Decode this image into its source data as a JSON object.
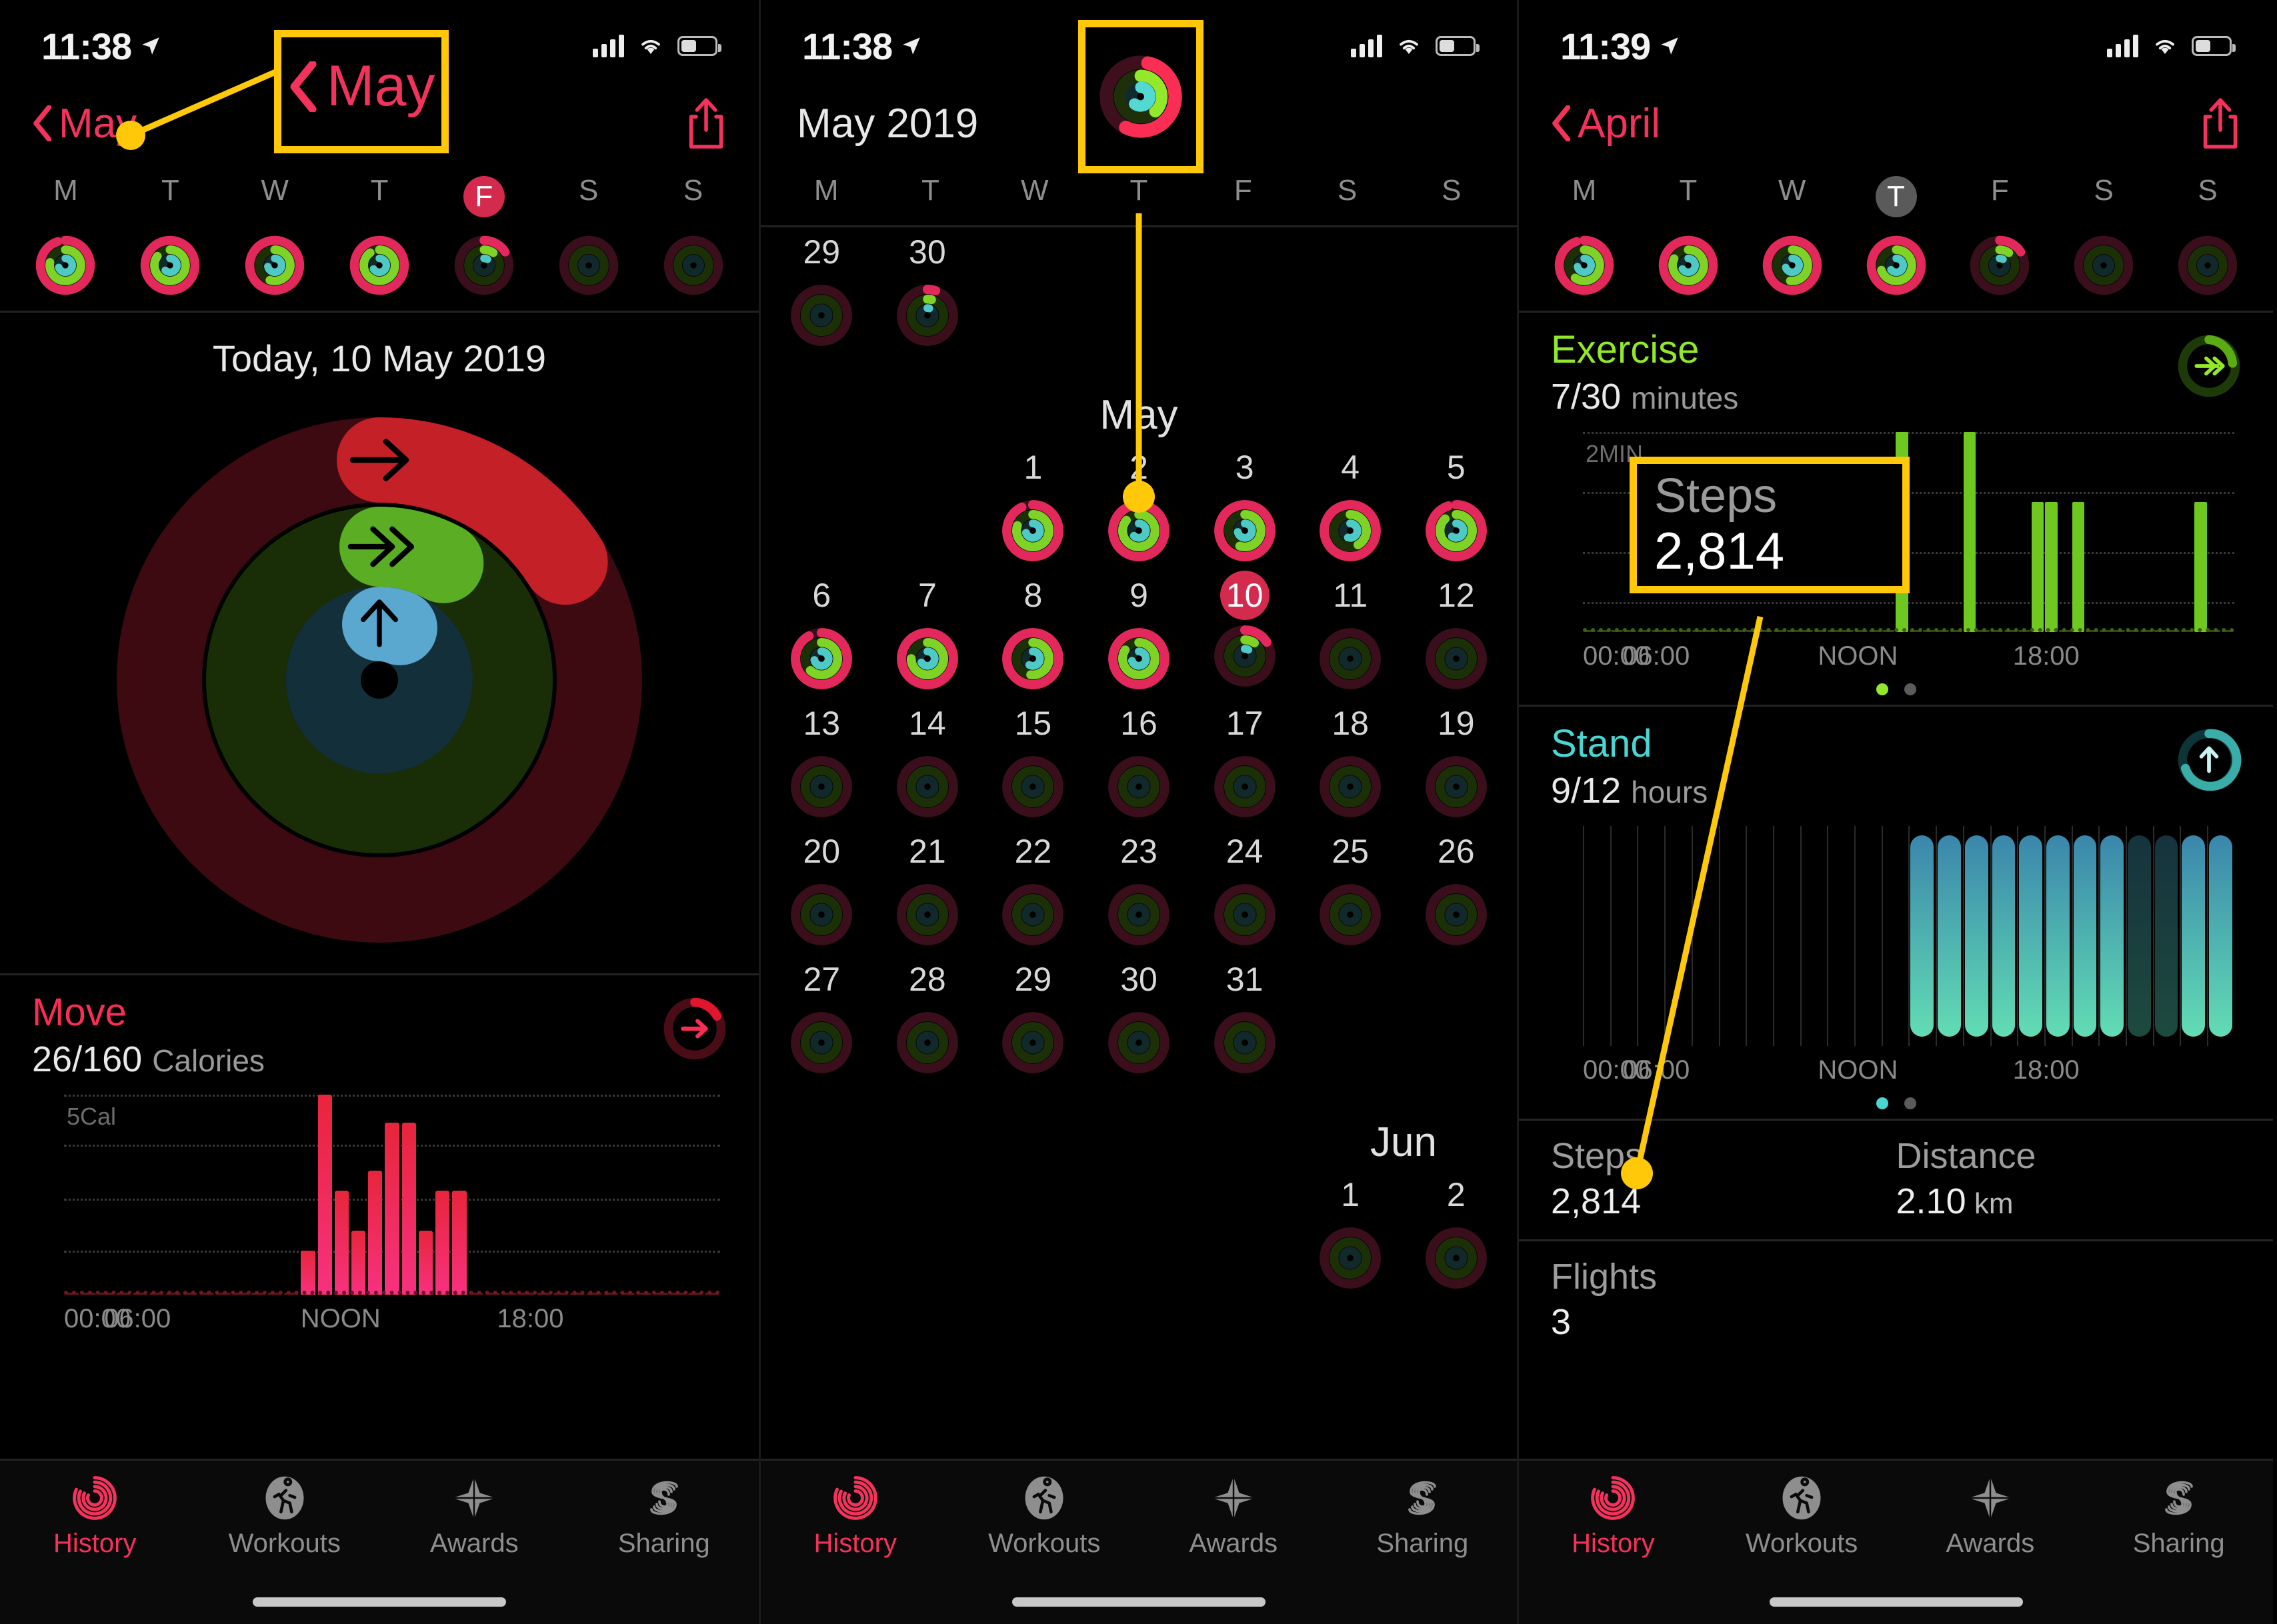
{
  "colors": {
    "move": "#fa2d55",
    "exercise": "#92e82a",
    "stand": "#4ad7d4",
    "accent_red": "#f4335c",
    "today_pill": "#d42a4e",
    "annotation": "#ffc909"
  },
  "panel1": {
    "status": {
      "time": "11:38"
    },
    "nav": {
      "back_label": "May",
      "share_icon": "share-icon"
    },
    "weekdays": [
      "M",
      "T",
      "W",
      "T",
      "F",
      "S",
      "S"
    ],
    "today_index": 4,
    "today_style": "red",
    "day_rings": [
      {
        "move": 0.95,
        "exercise": 0.78,
        "stand": 0.7
      },
      {
        "move": 1.0,
        "exercise": 0.85,
        "stand": 0.62
      },
      {
        "move": 1.0,
        "exercise": 0.55,
        "stand": 0.72
      },
      {
        "move": 1.0,
        "exercise": 0.9,
        "stand": 0.66
      },
      {
        "move": 0.16,
        "exercise": 0.1,
        "stand": 0.08
      },
      {
        "move": 0.0,
        "exercise": 0.0,
        "stand": 0.0
      },
      {
        "move": 0.0,
        "exercise": 0.0,
        "stand": 0.0
      }
    ],
    "today_label": "Today, 10 May 2019",
    "big_ring": {
      "move": 0.16,
      "exercise": 0.08,
      "stand": 0.06
    },
    "move": {
      "title": "Move",
      "value": "26/160",
      "unit": "Calories",
      "ylabel": "5Cal",
      "badge_icon": "arrow-right-icon",
      "xticks": [
        "00:00",
        "06:00",
        "NOON",
        "18:00"
      ]
    },
    "tabs": [
      {
        "label": "History",
        "icon": "rings-icon",
        "active": true
      },
      {
        "label": "Workouts",
        "icon": "runner-icon",
        "active": false
      },
      {
        "label": "Awards",
        "icon": "star-icon",
        "active": false
      },
      {
        "label": "Sharing",
        "icon": "sharing-icon",
        "active": false
      }
    ],
    "annotation": {
      "back_label": "May"
    }
  },
  "panel2": {
    "status": {
      "time": "11:38"
    },
    "nav": {
      "title": "May 2019"
    },
    "weekdays": [
      "M",
      "T",
      "W",
      "T",
      "F",
      "S",
      "S"
    ],
    "month_label": "May",
    "next_month_label": "Jun",
    "prev_days": [
      {
        "date": "29",
        "move": 0.0,
        "exercise": 0.0,
        "stand": 0.0
      },
      {
        "date": "30",
        "move": 0.05,
        "exercise": 0.04,
        "stand": 0.04
      }
    ],
    "weeks": [
      [
        null,
        null,
        {
          "date": "1",
          "move": 0.93,
          "exercise": 0.8,
          "stand": 0.7
        },
        {
          "date": "2",
          "move": 1.0,
          "exercise": 0.86,
          "stand": 0.62
        },
        {
          "date": "3",
          "move": 1.0,
          "exercise": 0.55,
          "stand": 0.72
        },
        {
          "date": "4",
          "move": 1.0,
          "exercise": 0.42,
          "stand": 0.55
        },
        {
          "date": "5",
          "move": 0.95,
          "exercise": 0.88,
          "stand": 0.6
        }
      ],
      [
        {
          "date": "6",
          "move": 0.92,
          "exercise": 0.62,
          "stand": 0.72
        },
        {
          "date": "7",
          "move": 1.0,
          "exercise": 0.75,
          "stand": 0.66
        },
        {
          "date": "8",
          "move": 1.0,
          "exercise": 0.52,
          "stand": 0.58
        },
        {
          "date": "9",
          "move": 1.0,
          "exercise": 0.84,
          "stand": 0.7
        },
        {
          "date": "10",
          "move": 0.16,
          "exercise": 0.1,
          "stand": 0.08,
          "today": true
        },
        {
          "date": "11",
          "move": 0.0,
          "exercise": 0.0,
          "stand": 0.0
        },
        {
          "date": "12",
          "move": 0.0,
          "exercise": 0.0,
          "stand": 0.0
        }
      ],
      [
        {
          "date": "13",
          "move": 0.0,
          "exercise": 0.0,
          "stand": 0.0
        },
        {
          "date": "14",
          "move": 0.0,
          "exercise": 0.0,
          "stand": 0.0
        },
        {
          "date": "15",
          "move": 0.0,
          "exercise": 0.0,
          "stand": 0.0
        },
        {
          "date": "16",
          "move": 0.0,
          "exercise": 0.0,
          "stand": 0.0
        },
        {
          "date": "17",
          "move": 0.0,
          "exercise": 0.0,
          "stand": 0.0
        },
        {
          "date": "18",
          "move": 0.0,
          "exercise": 0.0,
          "stand": 0.0
        },
        {
          "date": "19",
          "move": 0.0,
          "exercise": 0.0,
          "stand": 0.0
        }
      ],
      [
        {
          "date": "20",
          "move": 0.0,
          "exercise": 0.0,
          "stand": 0.0
        },
        {
          "date": "21",
          "move": 0.0,
          "exercise": 0.0,
          "stand": 0.0
        },
        {
          "date": "22",
          "move": 0.0,
          "exercise": 0.0,
          "stand": 0.0
        },
        {
          "date": "23",
          "move": 0.0,
          "exercise": 0.0,
          "stand": 0.0
        },
        {
          "date": "24",
          "move": 0.0,
          "exercise": 0.0,
          "stand": 0.0
        },
        {
          "date": "25",
          "move": 0.0,
          "exercise": 0.0,
          "stand": 0.0
        },
        {
          "date": "26",
          "move": 0.0,
          "exercise": 0.0,
          "stand": 0.0
        }
      ],
      [
        {
          "date": "27",
          "move": 0.0,
          "exercise": 0.0,
          "stand": 0.0
        },
        {
          "date": "28",
          "move": 0.0,
          "exercise": 0.0,
          "stand": 0.0
        },
        {
          "date": "29",
          "move": 0.0,
          "exercise": 0.0,
          "stand": 0.0
        },
        {
          "date": "30",
          "move": 0.0,
          "exercise": 0.0,
          "stand": 0.0
        },
        {
          "date": "31",
          "move": 0.0,
          "exercise": 0.0,
          "stand": 0.0
        },
        null,
        null
      ]
    ],
    "jun_week": [
      null,
      null,
      null,
      null,
      null,
      {
        "date": "1",
        "move": 0.0,
        "exercise": 0.0,
        "stand": 0.0
      },
      {
        "date": "2",
        "move": 0.0,
        "exercise": 0.0,
        "stand": 0.0
      }
    ],
    "tabs": [
      {
        "label": "History",
        "icon": "rings-icon",
        "active": true
      },
      {
        "label": "Workouts",
        "icon": "runner-icon",
        "active": false
      },
      {
        "label": "Awards",
        "icon": "star-icon",
        "active": false
      },
      {
        "label": "Sharing",
        "icon": "sharing-icon",
        "active": false
      }
    ],
    "annotation": {
      "target": "activity-rings-thumbnail"
    }
  },
  "panel3": {
    "status": {
      "time": "11:39"
    },
    "nav": {
      "back_label": "April",
      "share_icon": "share-icon"
    },
    "weekdays": [
      "M",
      "T",
      "W",
      "T",
      "F",
      "S",
      "S"
    ],
    "today_index": 3,
    "today_style": "gray",
    "day_rings": [
      {
        "move": 0.95,
        "exercise": 0.6,
        "stand": 0.72
      },
      {
        "move": 1.0,
        "exercise": 0.82,
        "stand": 0.66
      },
      {
        "move": 1.0,
        "exercise": 0.52,
        "stand": 0.7
      },
      {
        "move": 1.0,
        "exercise": 0.7,
        "stand": 0.64
      },
      {
        "move": 0.16,
        "exercise": 0.1,
        "stand": 0.08
      },
      {
        "move": 0.0,
        "exercise": 0.0,
        "stand": 0.0
      },
      {
        "move": 0.0,
        "exercise": 0.0,
        "stand": 0.0
      }
    ],
    "exercise": {
      "title": "Exercise",
      "value": "7/30",
      "unit": "minutes",
      "ylabel": "2MIN",
      "badge_icon": "double-chevron-right-icon",
      "xticks": [
        "00:00",
        "06:00",
        "NOON",
        "18:00"
      ]
    },
    "stand": {
      "title": "Stand",
      "value": "9/12",
      "unit": "hours",
      "badge_icon": "arrow-up-icon",
      "xticks": [
        "00:00",
        "06:00",
        "NOON",
        "18:00"
      ]
    },
    "stats": [
      {
        "label": "Steps",
        "value": "2,814",
        "unit": ""
      },
      {
        "label": "Distance",
        "value": "2.10",
        "unit": "km"
      }
    ],
    "stats2": [
      {
        "label": "Flights",
        "value": "3",
        "unit": ""
      }
    ],
    "tabs": [
      {
        "label": "History",
        "icon": "rings-icon",
        "active": true
      },
      {
        "label": "Workouts",
        "icon": "runner-icon",
        "active": false
      },
      {
        "label": "Awards",
        "icon": "star-icon",
        "active": false
      },
      {
        "label": "Sharing",
        "icon": "sharing-icon",
        "active": false
      }
    ],
    "annotation": {
      "label": "Steps",
      "value": "2,814"
    }
  },
  "chart_data": [
    {
      "type": "bar",
      "title": "Move",
      "subtitle": "26/160 Calories",
      "ylabel": "5Cal",
      "xlabel": "",
      "color": "#fa2d55",
      "xticks": [
        "00:00",
        "06:00",
        "NOON",
        "18:00"
      ],
      "ylim": [
        0,
        5
      ],
      "grid": true,
      "x": [
        "00:00",
        "00:30",
        "01:00",
        "01:30",
        "02:00",
        "02:30",
        "03:00",
        "03:30",
        "04:00",
        "04:30",
        "05:00",
        "05:30",
        "06:00",
        "06:30",
        "07:00",
        "07:15",
        "07:30",
        "07:45",
        "08:00",
        "08:15",
        "08:30",
        "08:45",
        "09:00",
        "09:15",
        "09:30",
        "10:00",
        "11:00",
        "12:00",
        "13:00",
        "14:00",
        "15:00",
        "16:00",
        "17:00",
        "18:00",
        "19:00",
        "20:00",
        "21:00",
        "22:00",
        "23:00"
      ],
      "values": [
        0,
        0,
        0,
        0,
        0,
        0,
        0,
        0,
        0,
        0,
        0,
        0,
        0,
        0,
        1.1,
        5.0,
        2.6,
        1.6,
        3.1,
        4.3,
        4.3,
        1.6,
        2.6,
        2.6,
        0,
        0,
        0,
        0,
        0,
        0,
        0,
        0,
        0,
        0,
        0,
        0,
        0,
        0,
        0
      ]
    },
    {
      "type": "bar",
      "title": "Exercise",
      "subtitle": "7/30 minutes",
      "ylabel": "2MIN",
      "color": "#92e82a",
      "xticks": [
        "00:00",
        "06:00",
        "NOON",
        "18:00"
      ],
      "ylim": [
        0,
        2
      ],
      "grid": true,
      "x": [
        "11:30",
        "14:00",
        "16:30",
        "17:15",
        "18:00",
        "22:30"
      ],
      "values": [
        2.0,
        2.0,
        1.3,
        1.3,
        1.3,
        1.3
      ]
    },
    {
      "type": "bar",
      "title": "Stand",
      "subtitle": "9/12 hours",
      "color": "#4ad7d4",
      "xticks": [
        "00:00",
        "06:00",
        "NOON",
        "18:00"
      ],
      "grid": true,
      "x": [
        "12:00",
        "13:00",
        "14:00",
        "15:00",
        "16:00",
        "17:00",
        "18:00",
        "19:00",
        "20:00",
        "21:00",
        "22:00"
      ],
      "values": [
        1,
        1,
        1,
        1,
        1,
        1,
        1,
        1,
        1,
        1,
        1
      ],
      "note": "Eleven stand hours shown as full-height rounded teal bars from NOON onward"
    }
  ]
}
